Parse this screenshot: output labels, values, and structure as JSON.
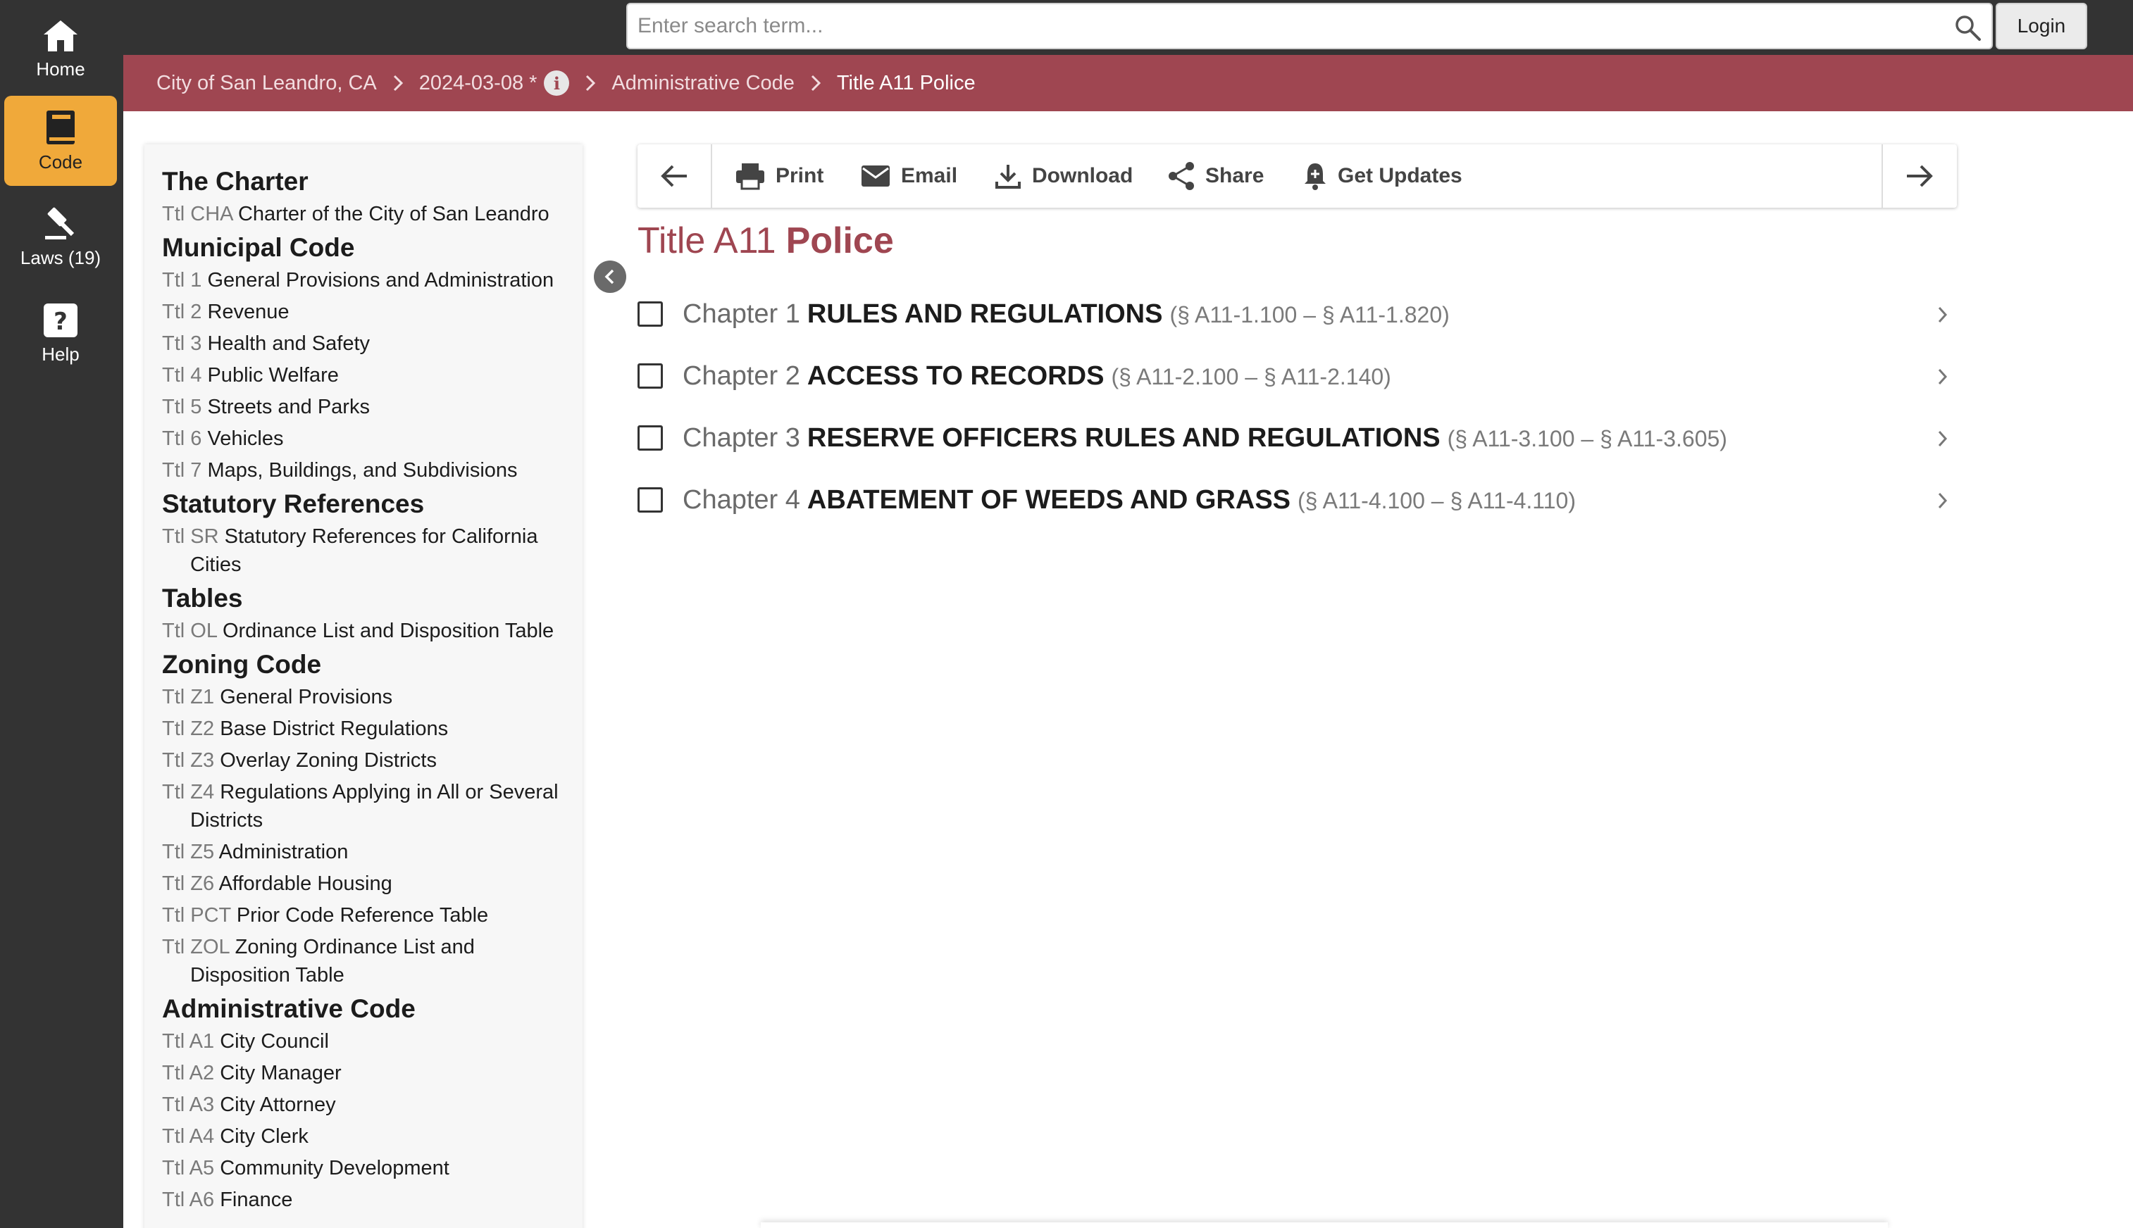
{
  "rail": {
    "items": [
      {
        "label": "Home",
        "icon": "home-icon"
      },
      {
        "label": "Code",
        "icon": "book-icon",
        "active": true
      },
      {
        "label": "Laws (19)",
        "icon": "gavel-icon"
      },
      {
        "label": "Help",
        "icon": "help-icon"
      }
    ]
  },
  "search": {
    "placeholder": "Enter search term...",
    "value": ""
  },
  "login_label": "Login",
  "breadcrumb": {
    "items": [
      "City of San Leandro, CA",
      "2024-03-08 *",
      "Administrative Code",
      "Title A11 Police"
    ]
  },
  "toc": {
    "groups": [
      {
        "title": "The Charter",
        "items": [
          {
            "num": "Ttl CHA",
            "name": "Charter of the City of San Leandro"
          }
        ]
      },
      {
        "title": "Municipal Code",
        "items": [
          {
            "num": "Ttl 1",
            "name": "General Provisions and Administration"
          },
          {
            "num": "Ttl 2",
            "name": "Revenue"
          },
          {
            "num": "Ttl 3",
            "name": "Health and Safety"
          },
          {
            "num": "Ttl 4",
            "name": "Public Welfare"
          },
          {
            "num": "Ttl 5",
            "name": "Streets and Parks"
          },
          {
            "num": "Ttl 6",
            "name": "Vehicles"
          },
          {
            "num": "Ttl 7",
            "name": "Maps, Buildings, and Subdivisions"
          }
        ]
      },
      {
        "title": "Statutory References",
        "items": [
          {
            "num": "Ttl SR",
            "name": "Statutory References for California Cities"
          }
        ]
      },
      {
        "title": "Tables",
        "items": [
          {
            "num": "Ttl OL",
            "name": "Ordinance List and Disposition Table"
          }
        ]
      },
      {
        "title": "Zoning Code",
        "items": [
          {
            "num": "Ttl Z1",
            "name": "General Provisions"
          },
          {
            "num": "Ttl Z2",
            "name": "Base District Regulations"
          },
          {
            "num": "Ttl Z3",
            "name": "Overlay Zoning Districts"
          },
          {
            "num": "Ttl Z4",
            "name": "Regulations Applying in All or Several Districts"
          },
          {
            "num": "Ttl Z5",
            "name": "Administration"
          },
          {
            "num": "Ttl Z6",
            "name": "Affordable Housing"
          },
          {
            "num": "Ttl PCT",
            "name": "Prior Code Reference Table"
          },
          {
            "num": "Ttl ZOL",
            "name": "Zoning Ordinance List and Disposition Table"
          }
        ]
      },
      {
        "title": "Administrative Code",
        "items": [
          {
            "num": "Ttl A1",
            "name": "City Council"
          },
          {
            "num": "Ttl A2",
            "name": "City Manager"
          },
          {
            "num": "Ttl A3",
            "name": "City Attorney"
          },
          {
            "num": "Ttl A4",
            "name": "City Clerk"
          },
          {
            "num": "Ttl A5",
            "name": "Community Development"
          },
          {
            "num": "Ttl A6",
            "name": "Finance"
          }
        ]
      }
    ]
  },
  "toolbar": {
    "print": "Print",
    "email": "Email",
    "download": "Download",
    "share": "Share",
    "updates": "Get Updates"
  },
  "title": {
    "num": "Title A11",
    "name": "Police"
  },
  "chapters": [
    {
      "num": "Chapter 1",
      "name": "RULES AND REGULATIONS",
      "range": "(§ A11-1.100 – § A11-1.820)"
    },
    {
      "num": "Chapter 2",
      "name": "ACCESS TO RECORDS",
      "range": "(§ A11-2.100 – § A11-2.140)"
    },
    {
      "num": "Chapter 3",
      "name": "RESERVE OFFICERS RULES AND REGULATIONS",
      "range": "(§ A11-3.100 – § A11-3.605)"
    },
    {
      "num": "Chapter 4",
      "name": "ABATEMENT OF WEEDS AND GRASS",
      "range": "(§ A11-4.100 – § A11-4.110)"
    }
  ],
  "colors": {
    "brand": "#9f4651",
    "accent": "#f0a93a",
    "rail": "#333333"
  }
}
